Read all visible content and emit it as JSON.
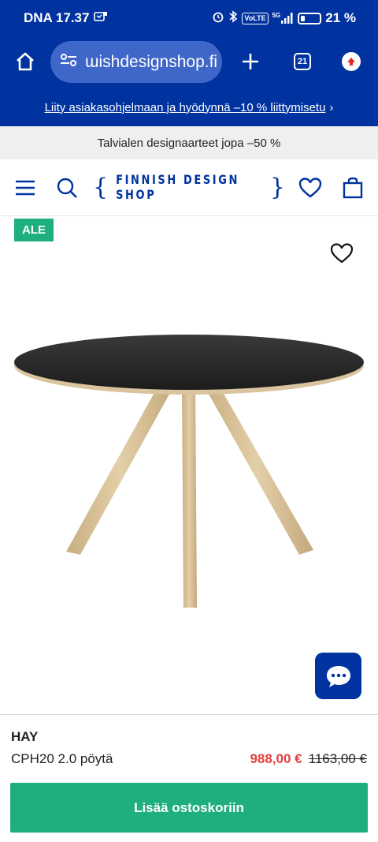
{
  "status_bar": {
    "carrier_time": "DNA 17.37",
    "net_5g": "5G",
    "volte": "VoLTE",
    "battery_pct": "21 %"
  },
  "browser": {
    "url": "ɯishdesignshop.fi",
    "tab_count": "21"
  },
  "promo": {
    "text": "Liity asiakasohjelmaan ja hyödynnä –10 % liittymisetu",
    "chevron": "›"
  },
  "info_bar": {
    "text": "Talvialen designaarteet jopa –50 %"
  },
  "header": {
    "logo_text": "FINNISH DESIGN SHOP",
    "brace_left": "{",
    "brace_right": "}"
  },
  "product": {
    "badge": "ALE",
    "brand": "HAY",
    "name": "CPH20 2.0 pöytä",
    "price_sale": "988,00 €",
    "price_old": "1163,00 €",
    "add_to_cart": "Lisää ostoskoriin"
  },
  "colors": {
    "brand_blue": "#0033a0",
    "url_field": "#3f67c9",
    "sale_green": "#1fae7e",
    "sale_red": "#e53f3f"
  },
  "icons": [
    "home-icon",
    "tune-icon",
    "plus-icon",
    "tabs-icon",
    "update-icon",
    "menu-icon",
    "search-icon",
    "heart-icon",
    "bag-icon",
    "chat-icon"
  ]
}
